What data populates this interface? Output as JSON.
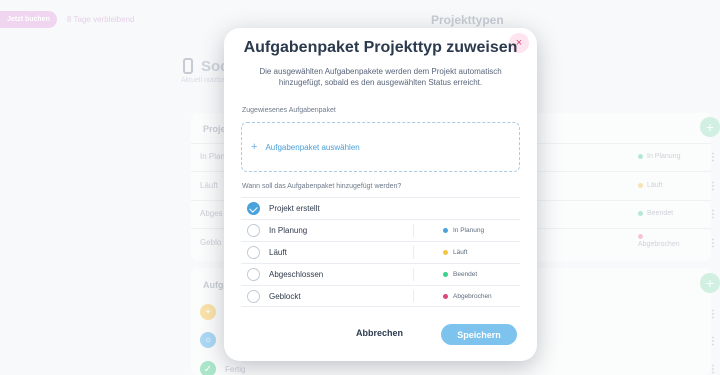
{
  "background": {
    "header_button": "Jetzt buchen",
    "days_left": "8 Tage verbleibend",
    "page_title": "Projekttypen",
    "project_type_name": "Soc",
    "project_type_sub": "Aktuell nutzba",
    "card1_heading": "Proje",
    "rows": [
      {
        "label": "In Planung",
        "status": "In Planung",
        "color": "#8fdcbf"
      },
      {
        "label": "Läuft",
        "status": "Läuft",
        "color": "#f3d58a"
      },
      {
        "label": "Abgeschlossen",
        "status": "Beendet",
        "color": "#8fdcbf"
      },
      {
        "label": "Geblockt",
        "status": "Abgebrochen",
        "color": "#f2a7c4"
      }
    ],
    "row_labels_short": [
      "In Planu",
      "Läuft",
      "Abges",
      "Geblo"
    ],
    "card2_heading": "Aufga",
    "card2_last_item": "Fertig"
  },
  "modal": {
    "title": "Aufgabenpaket Projekttyp zuweisen",
    "description": "Die ausgewählten Aufgabenpakete werden dem Projekt automatisch hinzugefügt, sobald es den ausgewählten Status erreicht.",
    "assigned_label": "Zugewiesenes Aufgabenpaket",
    "select_package": "Aufgabenpaket auswählen",
    "when_label": "Wann soll das Aufgabenpaket hinzugefügt werden?",
    "options": [
      {
        "label": "Projekt erstellt",
        "selected": true,
        "badge": "",
        "badge_color": ""
      },
      {
        "label": "In Planung",
        "selected": false,
        "badge": "In Planung",
        "badge_color": "#4aa2dc"
      },
      {
        "label": "Läuft",
        "selected": false,
        "badge": "Läuft",
        "badge_color": "#f5c542"
      },
      {
        "label": "Abgeschlossen",
        "selected": false,
        "badge": "Beendet",
        "badge_color": "#3ccf8e"
      },
      {
        "label": "Geblockt",
        "selected": false,
        "badge": "Abgebrochen",
        "badge_color": "#e0457b"
      }
    ],
    "cancel_label": "Abbrechen",
    "save_label": "Speichern",
    "close_icon": "×"
  }
}
